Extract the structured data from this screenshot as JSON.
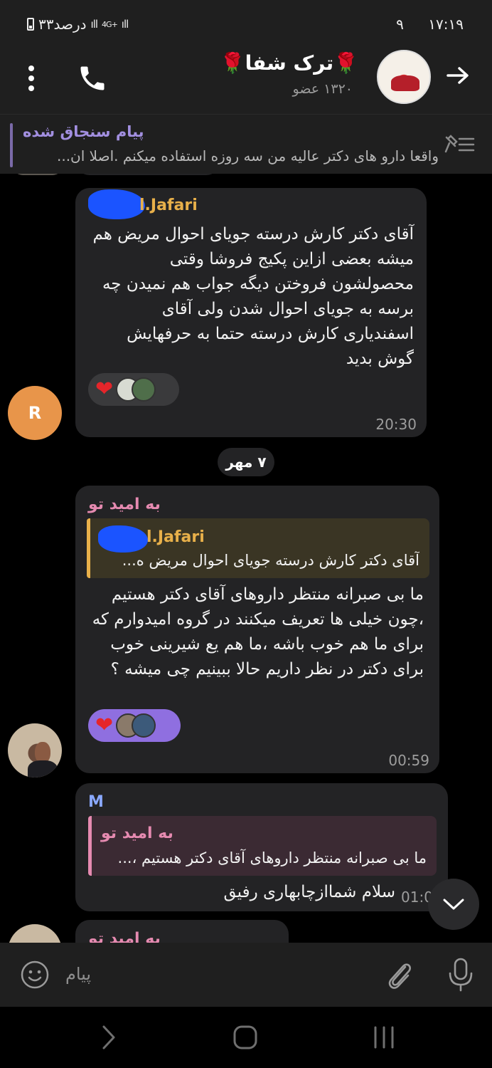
{
  "status_bar": {
    "time": "۱۷:۱۹",
    "notification_count": "۹",
    "battery": "۳۳درصد",
    "network": "4G+"
  },
  "header": {
    "title": "🌹ترک شفا🌹",
    "members": "۱۳۲۰ عضو"
  },
  "pinned": {
    "title": "پیام سنجاق شده",
    "text": "واقعا دارو های دکتر عالیه من سه روزه استفاده میکنم .اصلا ان..."
  },
  "messages": [
    {
      "sender": "l.Jafari",
      "text": "آقای دکتر کارش درسته جویای احوال مریض هم میشه بعضی ازاین پکیج فروشا وقتی محصولشون فروختن دیگه جواب هم نمیدن چه برسه به جویای احوال شدن ولی آقای اسفندیاری کارش درسته حتما به حرفهایش گوش بدید",
      "time": "20:30",
      "avatar_letter": "R"
    },
    {
      "sender": "به امید تو",
      "reply_sender": "l.Jafari",
      "reply_text": "آقای دکتر کارش درسته جویای احوال مریض ه...",
      "text": "ما بی صبرانه منتظر داروهای آقای دکتر هستیم ،چون خیلی ها تعریف میکنند در گروه امیدوارم که برای ما هم خوب باشه ،ما هم یع شیرینی خوب برای دکتر در نظر داریم حالا ببینیم چی میشه ؟",
      "time": "00:59"
    },
    {
      "sender": "M",
      "reply_sender": "به امید تو",
      "reply_text": "ما بی صبرانه منتظر داروهای آقای دکتر هستیم ،...",
      "text": "سلام شماازچابهاری رفیق",
      "time": "01:0"
    },
    {
      "sender": "به امید تو"
    }
  ],
  "date_separator": "۷ مهر",
  "input": {
    "placeholder": "پیام"
  },
  "colors": {
    "bubble": "#232325",
    "jafari_name": "#e8b04a",
    "omid_name": "#e58ab0",
    "m_name": "#8aa8ff",
    "pinned_title": "#a28fe0",
    "heart": "#e5252a"
  }
}
